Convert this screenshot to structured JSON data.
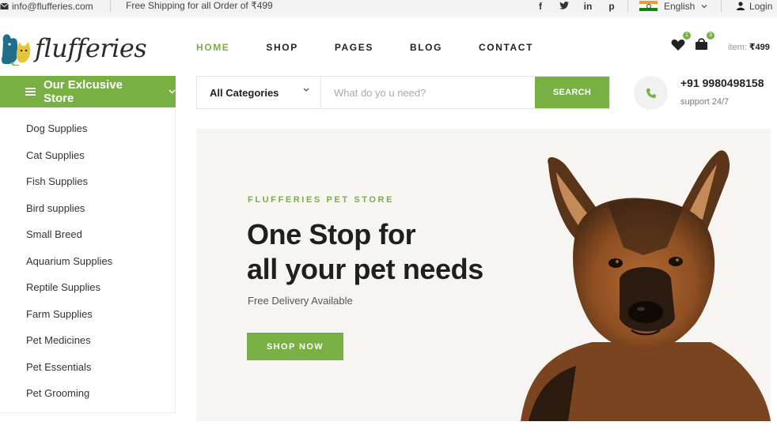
{
  "topbar": {
    "email": "info@flufferies.com",
    "shipping": "Free Shipping for all Order of ₹499",
    "social": [
      "f",
      "t",
      "in",
      "p"
    ],
    "language": "English",
    "login": "Login"
  },
  "brand": {
    "name": "flufferies"
  },
  "nav": [
    {
      "label": "HOME",
      "active": true
    },
    {
      "label": "SHOP"
    },
    {
      "label": "PAGES"
    },
    {
      "label": "BLOG"
    },
    {
      "label": "CONTACT"
    }
  ],
  "header": {
    "wishlist_count": "1",
    "cart_count": "3",
    "cart_label": "item:",
    "cart_total": "₹499"
  },
  "store_button": {
    "label": "Our Exlcusive Store"
  },
  "search": {
    "category": "All Categories",
    "placeholder": "What do yo u need?",
    "button": "SEARCH"
  },
  "support": {
    "phone": "+91 9980498158",
    "label": "support 24/7"
  },
  "categories": [
    "Dog Supplies",
    "Cat Supplies",
    "Fish Supplies",
    "Bird supplies",
    "Small Breed",
    "Aquarium Supplies",
    "Reptile Supplies",
    "Farm Supplies",
    "Pet Medicines",
    "Pet Essentials",
    "Pet Grooming"
  ],
  "hero": {
    "kicker": "FLUFFERIES PET STORE",
    "title_line1": "One Stop for",
    "title_line2": "all your pet needs",
    "subtitle": "Free Delivery Available",
    "cta": "SHOP NOW"
  },
  "colors": {
    "accent": "#78b043",
    "topbar_bg": "#f3f3f3",
    "hero_bg": "#f7f5f2"
  }
}
